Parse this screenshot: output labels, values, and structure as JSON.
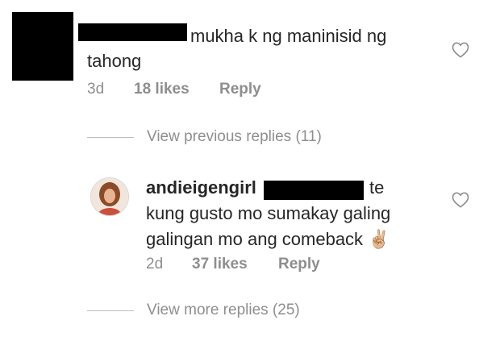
{
  "comment1": {
    "text_part1": "mukha k ng maninisid ng",
    "text_part2": "tahong",
    "time": "3d",
    "likes": "18 likes",
    "reply_label": "Reply"
  },
  "view_previous": "View previous replies (11)",
  "comment2": {
    "username": "andieigengirl",
    "text_part1": "te",
    "text_line2": "kung gusto mo sumakay galing",
    "text_line3": "galingan mo ang comeback",
    "emoji": "✌🏼",
    "time": "2d",
    "likes": "37 likes",
    "reply_label": "Reply"
  },
  "view_more": "View more replies (25)",
  "icons": {
    "heart": "heart-outline-icon"
  },
  "colors": {
    "text": "#262626",
    "secondary": "#8e8e8e",
    "redaction": "#000000"
  }
}
